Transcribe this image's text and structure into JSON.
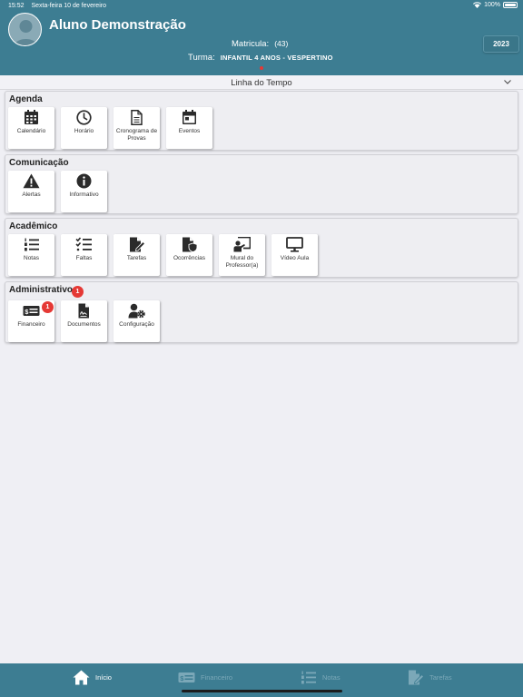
{
  "status_bar": {
    "time": "15:52",
    "date": "Sexta-feira 10 de fevereiro",
    "battery": "100%"
  },
  "header": {
    "student_name": "Aluno Demonstração",
    "matricula_label": "Matricula:",
    "matricula_value": "(43)",
    "turma_label": "Turma:",
    "turma_value": "INFANTIL 4 ANOS - VESPERTINO",
    "year": "2023"
  },
  "timeline": {
    "label": "Linha do Tempo",
    "icon": "chevron-down-icon"
  },
  "sections": [
    {
      "title": "Agenda",
      "tiles": [
        {
          "label": "Calendário",
          "icon": "calendar-icon"
        },
        {
          "label": "Horário",
          "icon": "clock-icon"
        },
        {
          "label": "Cronograma de Provas",
          "icon": "document-icon"
        },
        {
          "label": "Eventos",
          "icon": "calendar-day-icon"
        }
      ]
    },
    {
      "title": "Comunicação",
      "tiles": [
        {
          "label": "Alertas",
          "icon": "warning-icon"
        },
        {
          "label": "Informativo",
          "icon": "info-icon"
        }
      ]
    },
    {
      "title": "Acadêmico",
      "tiles": [
        {
          "label": "Notas",
          "icon": "numbered-list-icon"
        },
        {
          "label": "Faltas",
          "icon": "checklist-icon"
        },
        {
          "label": "Tarefas",
          "icon": "file-edit-icon"
        },
        {
          "label": "Ocorrências",
          "icon": "file-shield-icon"
        },
        {
          "label": "Mural do Professor(a)",
          "icon": "chalkboard-teacher-icon"
        },
        {
          "label": "Vídeo Aula",
          "icon": "monitor-icon"
        }
      ]
    },
    {
      "title": "Administrativo",
      "badge": "1",
      "tiles": [
        {
          "label": "Financeiro",
          "icon": "money-bill-icon",
          "badge": "1"
        },
        {
          "label": "Documentos",
          "icon": "file-signature-icon"
        },
        {
          "label": "Configuração",
          "icon": "user-cog-icon"
        }
      ]
    }
  ],
  "tabbar": {
    "tabs": [
      {
        "label": "Início",
        "icon": "home-icon",
        "active": true
      },
      {
        "label": "Financeiro",
        "icon": "money-bill-icon",
        "active": false
      },
      {
        "label": "Notas",
        "icon": "numbered-list-icon",
        "active": false
      },
      {
        "label": "Tarefas",
        "icon": "file-edit-icon",
        "active": false
      }
    ]
  },
  "colors": {
    "header": "#3d7d92",
    "badge": "#e53935",
    "background": "#efeff4"
  }
}
